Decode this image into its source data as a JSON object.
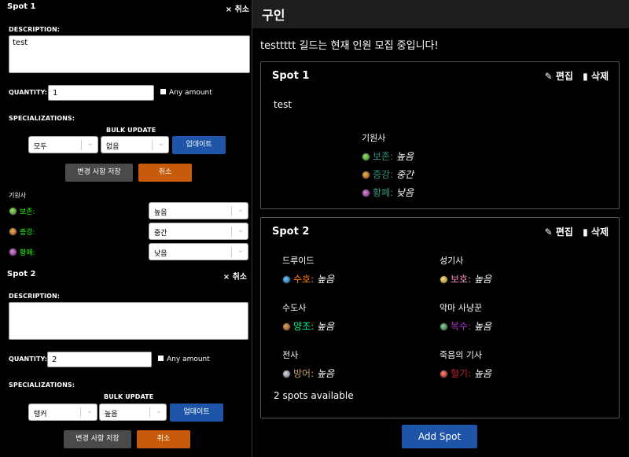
{
  "editor": {
    "spot1": {
      "title": "Spot 1",
      "cancel_label": "× 취소",
      "description_label": "DESCRIPTION:",
      "description_value": "test",
      "quantity_label": "QUANTITY:",
      "quantity_value": "1",
      "any_amount_label": "Any amount",
      "specializations_label": "SPECIALIZATIONS:",
      "bulk_update_label": "BULK UPDATE",
      "bulk_class_value": "모두",
      "bulk_priority_value": "없음",
      "update_button": "업데이트",
      "save_button": "변경 사항 저장",
      "cancel_button": "취소",
      "class_name": "기원사",
      "specs": [
        {
          "name": "보존:",
          "value": "높음"
        },
        {
          "name": "증강:",
          "value": "중간"
        },
        {
          "name": "황폐:",
          "value": "낮음"
        }
      ]
    },
    "spot2": {
      "title": "Spot 2",
      "cancel_label": "× 취소",
      "description_label": "DESCRIPTION:",
      "description_value": "",
      "quantity_label": "QUANTITY:",
      "quantity_value": "2",
      "any_amount_label": "Any amount",
      "specializations_label": "SPECIALIZATIONS:",
      "bulk_update_label": "BULK UPDATE",
      "bulk_class_value": "탱커",
      "bulk_priority_value": "높음",
      "update_button": "업데이트",
      "save_button": "변경 사항 저장",
      "cancel_button": "취소"
    }
  },
  "panel": {
    "title": "구인",
    "intro": "testtttt 길드는 현재 인원 모집 중입니다!",
    "edit_label": "✎ 편집",
    "delete_label": "▮ 삭제",
    "spot1": {
      "title": "Spot 1",
      "description": "test",
      "class_name": "기원사",
      "specs": [
        {
          "name": "보존:",
          "value": "높음"
        },
        {
          "name": "증강:",
          "value": "중간"
        },
        {
          "name": "황폐:",
          "value": "낮음"
        }
      ]
    },
    "spot2": {
      "title": "Spot 2",
      "groups": [
        {
          "class": "드루이드",
          "spec": "수호:",
          "value": "높음",
          "color": "#ff7c0a"
        },
        {
          "class": "성기사",
          "spec": "보호:",
          "value": "높음",
          "color": "#f48cba"
        },
        {
          "class": "수도사",
          "spec": "양조:",
          "value": "높음",
          "color": "#00ff98"
        },
        {
          "class": "악마 사냥꾼",
          "spec": "복수:",
          "value": "높음",
          "color": "#a330c9"
        },
        {
          "class": "전사",
          "spec": "방어:",
          "value": "높음",
          "color": "#c69b6d"
        },
        {
          "class": "죽음의 기사",
          "spec": "혈기:",
          "value": "높음",
          "color": "#c41e3a"
        }
      ],
      "available": "2 spots available"
    },
    "add_spot": "Add Spot"
  },
  "colors": {
    "evoker": "#33937f",
    "button_blue": "#1f55a8",
    "button_orange": "#c75b09",
    "button_grey": "#4a4a4a"
  },
  "icons": [
    "preservation-icon",
    "augmentation-icon",
    "devastation-icon",
    "guardian-icon",
    "protection-icon",
    "brewmaster-icon",
    "vengeance-icon",
    "arms-protection-icon",
    "blood-icon",
    "pencil-icon",
    "trash-icon"
  ]
}
